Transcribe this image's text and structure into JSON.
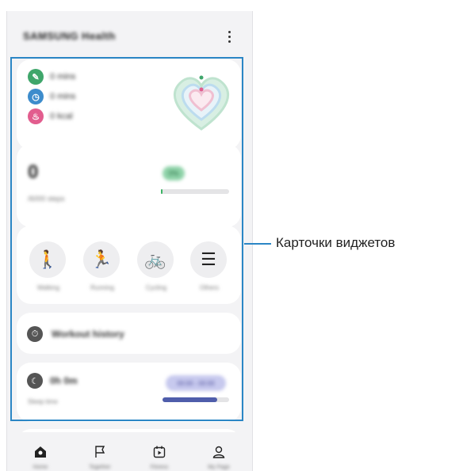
{
  "app_bar": {
    "title": "SAMSUNG Health"
  },
  "activity_card": {
    "rows": [
      {
        "value": "0 mins",
        "color": "#3fa66b",
        "icon": "steps-icon"
      },
      {
        "value": "0 mins",
        "color": "#3d8ccc",
        "icon": "clock-icon"
      },
      {
        "value": "0 kcal",
        "color": "#e25d8e",
        "icon": "flame-icon"
      }
    ]
  },
  "steps_card": {
    "count": "0",
    "goal": "/6000 steps",
    "badge": "0%",
    "progress_percent": 2
  },
  "quick_actions": {
    "items": [
      {
        "label": "Walking",
        "icon": "walking-icon"
      },
      {
        "label": "Running",
        "icon": "running-icon"
      },
      {
        "label": "Cycling",
        "icon": "cycling-icon"
      },
      {
        "label": "Others",
        "icon": "list-icon"
      }
    ]
  },
  "workout_card": {
    "label": "Workout history"
  },
  "sleep_card": {
    "time": "0h 0m",
    "sub": "Sleep time",
    "pill": "00:00 - 00:00",
    "progress_percent": 82
  },
  "bottom_nav": {
    "items": [
      {
        "label": "Home",
        "icon": "home-icon"
      },
      {
        "label": "Together",
        "icon": "flag-icon"
      },
      {
        "label": "Fitness",
        "icon": "calendar-play-icon"
      },
      {
        "label": "My Page",
        "icon": "person-icon"
      }
    ]
  },
  "colors": {
    "highlight": "#2b86c5",
    "walking_green": "#3bb364",
    "sleep_blue": "#4f5dab"
  },
  "callout": {
    "label": "Карточки виджетов"
  }
}
